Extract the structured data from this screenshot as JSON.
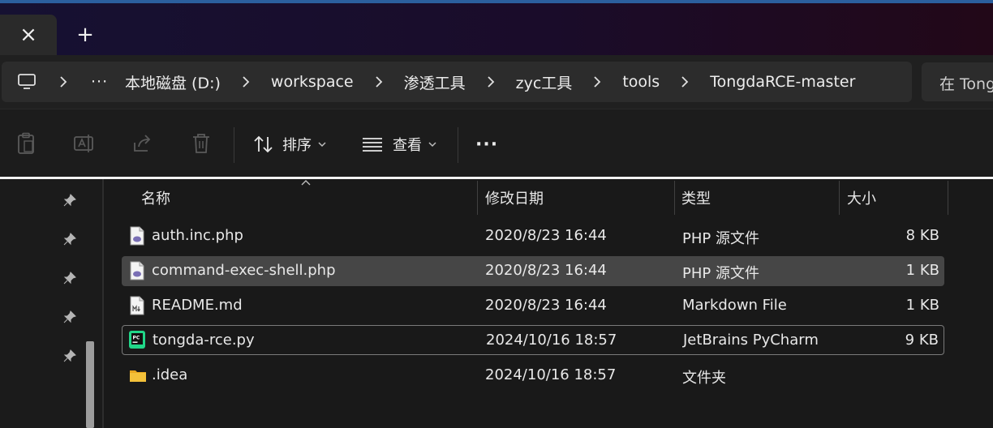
{
  "tabs": {
    "close_glyph": "×",
    "new_glyph": "+"
  },
  "address": {
    "overflow_glyph": "···",
    "crumbs": [
      "本地磁盘 (D:)",
      "workspace",
      "渗透工具",
      "zyc工具",
      "tools",
      "TongdaRCE-master"
    ],
    "search_text": "在 Tong"
  },
  "toolbar": {
    "sort_label": "排序",
    "view_label": "查看",
    "more_glyph": "···"
  },
  "columns": {
    "name": "名称",
    "date": "修改日期",
    "type": "类型",
    "size": "大小"
  },
  "files": [
    {
      "name": "auth.inc.php",
      "date": "2020/8/23 16:44",
      "type": "PHP 源文件",
      "size": "8 KB",
      "icon": "php-file-icon"
    },
    {
      "name": "command-exec-shell.php",
      "date": "2020/8/23 16:44",
      "type": "PHP 源文件",
      "size": "1 KB",
      "icon": "php-file-icon"
    },
    {
      "name": "README.md",
      "date": "2020/8/23 16:44",
      "type": "Markdown File",
      "size": "1 KB",
      "icon": "markdown-file-icon"
    },
    {
      "name": "tongda-rce.py",
      "date": "2024/10/16 18:57",
      "type": "JetBrains PyCharm",
      "size": "9 KB",
      "icon": "pycharm-file-icon"
    },
    {
      "name": ".idea",
      "date": "2024/10/16 18:57",
      "type": "文件夹",
      "size": "",
      "icon": "folder-icon"
    }
  ],
  "colors": {
    "accent": "#2b5f9e",
    "selected_row": "#464646",
    "folder": "#f3c13a"
  }
}
